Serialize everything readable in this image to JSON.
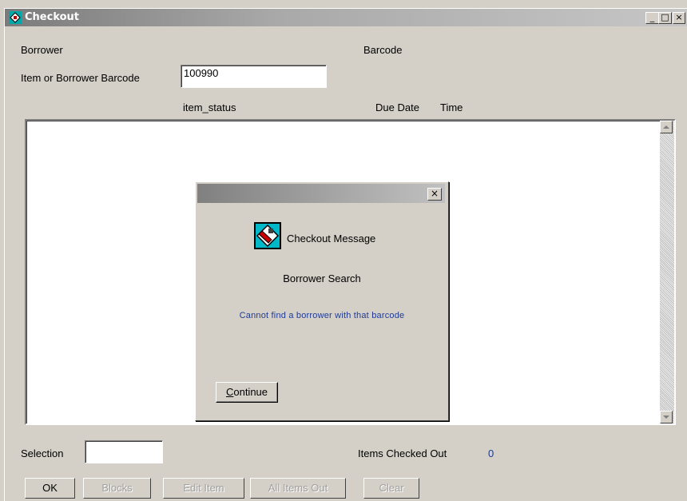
{
  "window": {
    "title": "Checkout",
    "minimize": "_",
    "maximize": "□",
    "close": "×"
  },
  "form": {
    "borrower_label": "Borrower",
    "barcode_label": "Barcode",
    "item_or_borrower_label": "Item or Borrower Barcode",
    "barcode_value": "100990"
  },
  "columns": {
    "item_status": "item_status",
    "due_date": "Due Date",
    "time": "Time"
  },
  "footer": {
    "selection_label": "Selection",
    "selection_value": "",
    "items_checked_out_label": "Items Checked Out",
    "items_checked_out_count": "0"
  },
  "buttons": {
    "ok": "OK",
    "blocks": "Blocks",
    "edit_item": "Edit Item",
    "all_items_out": "All Items Out",
    "clear": "Clear"
  },
  "dialog": {
    "close": "×",
    "heading": "Checkout Message",
    "subheading": "Borrower Search",
    "message": "Cannot find a borrower with that barcode",
    "continue_rest": "ontinue",
    "continue_mnemonic": "C"
  },
  "colors": {
    "message_text": "#1f3a93",
    "count_text": "#1f3a93"
  }
}
